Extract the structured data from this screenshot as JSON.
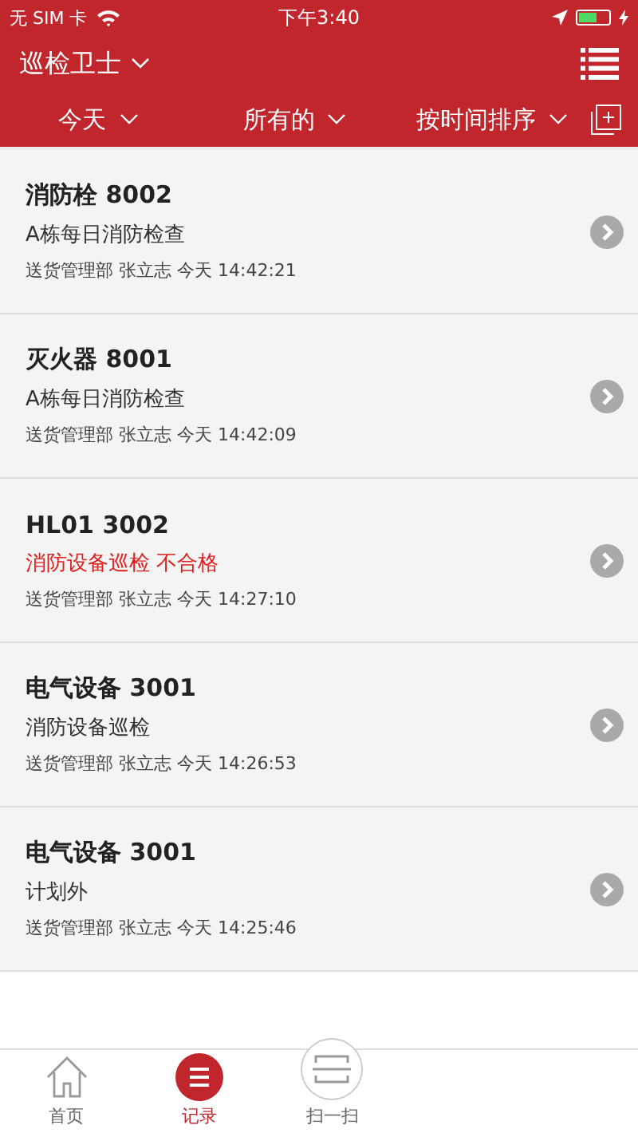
{
  "status_bar": {
    "carrier": "无 SIM 卡",
    "time": "下午3:40"
  },
  "nav": {
    "title": "巡检卫士"
  },
  "filters": [
    {
      "label": "今天"
    },
    {
      "label": "所有的"
    },
    {
      "label": "按时间排序"
    }
  ],
  "records": [
    {
      "title": "消防栓 8002",
      "subtitle": "A栋每日消防检查",
      "failed": false,
      "meta": "送货管理部 张立志 今天 14:42:21"
    },
    {
      "title": "灭火器 8001",
      "subtitle": "A栋每日消防检查",
      "failed": false,
      "meta": "送货管理部 张立志 今天 14:42:09"
    },
    {
      "title": "HL01 3002",
      "subtitle": "消防设备巡检 不合格",
      "failed": true,
      "meta": "送货管理部 张立志 今天 14:27:10"
    },
    {
      "title": "电气设备 3001",
      "subtitle": "消防设备巡检",
      "failed": false,
      "meta": "送货管理部 张立志 今天 14:26:53"
    },
    {
      "title": "电气设备 3001",
      "subtitle": "计划外",
      "failed": false,
      "meta": "送货管理部 张立志 今天 14:25:46"
    }
  ],
  "tabbar": [
    {
      "kind": "home",
      "label": "首页",
      "selected": false
    },
    {
      "kind": "records",
      "label": "记录",
      "selected": true
    },
    {
      "kind": "scan",
      "label": "扫一扫",
      "selected": false
    }
  ]
}
